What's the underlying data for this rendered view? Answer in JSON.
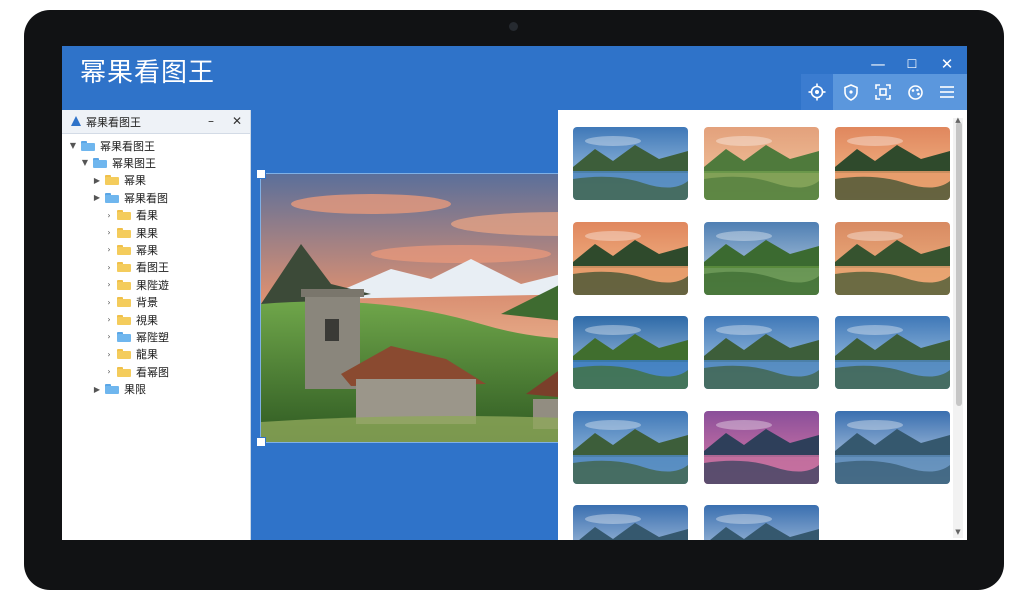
{
  "app": {
    "title": "幂果看图王"
  },
  "window_controls": {
    "minimize": "—",
    "maximize": "☐",
    "close": "✕"
  },
  "toolbar": {
    "buttons": [
      {
        "icon": "settings-gear-icon",
        "active": true
      },
      {
        "icon": "shield-icon",
        "active": false
      },
      {
        "icon": "scan-frame-icon",
        "active": false
      },
      {
        "icon": "palette-icon",
        "active": false
      },
      {
        "icon": "menu-icon",
        "active": false
      }
    ]
  },
  "tree": {
    "title": "幂果看图王",
    "minimize": "–",
    "close": "✕",
    "items": [
      {
        "label": "幂果看图王",
        "level": 0,
        "caret": "▼",
        "folder": "blue"
      },
      {
        "label": "幂果图王",
        "level": 1,
        "caret": "▼",
        "folder": "blue"
      },
      {
        "label": "幂果",
        "level": 2,
        "caret": "▶",
        "folder": "yellow"
      },
      {
        "label": "幂果看图",
        "level": 2,
        "caret": "▶",
        "folder": "blue"
      },
      {
        "label": "看果",
        "level": 3,
        "caret": "›",
        "folder": "yellow"
      },
      {
        "label": "果果",
        "level": 3,
        "caret": "›",
        "folder": "yellow"
      },
      {
        "label": "幂果",
        "level": 3,
        "caret": "›",
        "folder": "yellow"
      },
      {
        "label": "看图王",
        "level": 3,
        "caret": "›",
        "folder": "yellow"
      },
      {
        "label": "果陛遊",
        "level": 3,
        "caret": "›",
        "folder": "yellow"
      },
      {
        "label": "背景",
        "level": 3,
        "caret": "›",
        "folder": "yellow"
      },
      {
        "label": "視果",
        "level": 3,
        "caret": "›",
        "folder": "yellow"
      },
      {
        "label": "幂陛塑",
        "level": 3,
        "caret": "›",
        "folder": "blue"
      },
      {
        "label": "龍果",
        "level": 3,
        "caret": "›",
        "folder": "yellow"
      },
      {
        "label": "看幂图",
        "level": 3,
        "caret": "›",
        "folder": "yellow"
      },
      {
        "label": "果限",
        "level": 2,
        "caret": "▶",
        "folder": "blue"
      }
    ]
  },
  "gallery": {
    "thumbnails": [
      {
        "scene": "mountain-lake-blue"
      },
      {
        "scene": "village-sunset"
      },
      {
        "scene": "sunset-lake-reflection"
      },
      {
        "scene": "sunset-lake-reflection"
      },
      {
        "scene": "mountain-meadow-blue"
      },
      {
        "scene": "mountain-lake-sunset"
      },
      {
        "scene": "river-valley-dusk"
      },
      {
        "scene": "mountain-lake-blue"
      },
      {
        "scene": "mountain-lake-blue"
      },
      {
        "scene": "mountain-lake-blue"
      },
      {
        "scene": "pink-sky-lake"
      },
      {
        "scene": "clouds-mountains"
      },
      {
        "scene": "clouds-mountains"
      },
      {
        "scene": "clouds-mountains"
      }
    ]
  },
  "preview": {
    "scene": "stone-cottage-valley-sunset"
  },
  "colors": {
    "accent": "#2f73c9",
    "toolbar": "#5b97dd",
    "panel_bg": "#ffffff"
  }
}
